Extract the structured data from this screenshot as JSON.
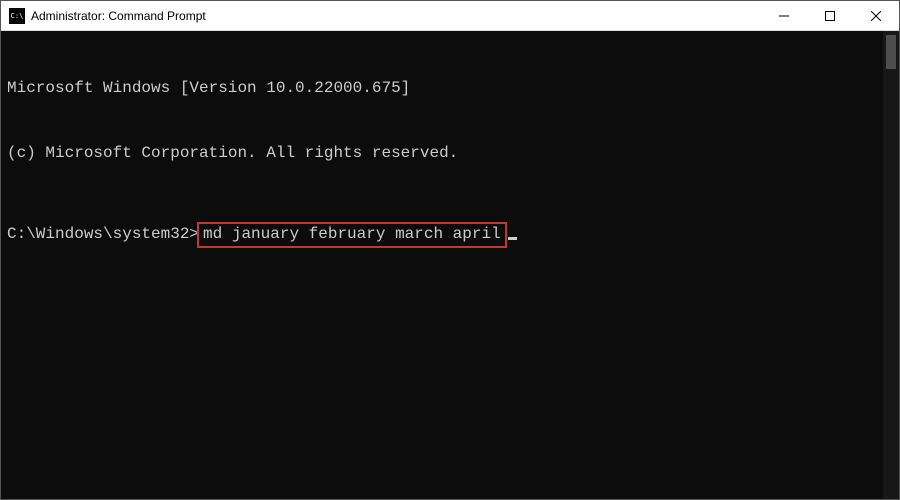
{
  "titlebar": {
    "title": "Administrator: Command Prompt"
  },
  "terminal": {
    "line1": "Microsoft Windows [Version 10.0.22000.675]",
    "line2": "(c) Microsoft Corporation. All rights reserved.",
    "prompt": "C:\\Windows\\system32>",
    "command": "md january february march april"
  }
}
